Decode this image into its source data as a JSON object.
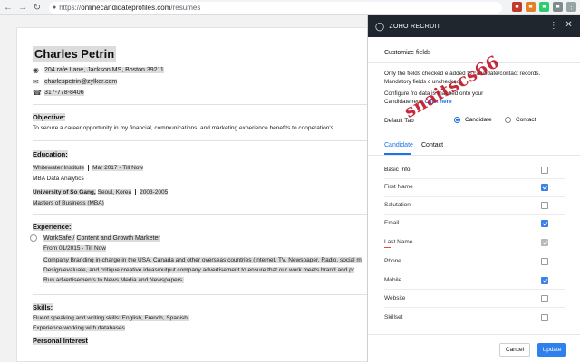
{
  "browser": {
    "url_host": "onlinecandidateprofiles.com",
    "url_path": "/resumes",
    "url_prefix": "https://"
  },
  "resume": {
    "name": "Charles Petrin",
    "address": "204 rafe Lane, Jackson MS, Boston 39211",
    "email": "charlespetrin@zylker.com",
    "phone": "317-778-8406",
    "objective_heading": "Objective:",
    "objective_text": "To secure a career opportunity in my financial, communications, and marketing experience benefits to cooperation's",
    "education_heading": "Education:",
    "edu1_school": "Whitewater Institute",
    "edu1_dates": "Mar 2017 - Till Now",
    "edu1_degree": "MBA Data Analytics",
    "edu2_school": "University of So Gang,",
    "edu2_location": "Seoul, Korea",
    "edu2_dates": "2003-2005",
    "edu2_degree": "Masters of Business (MBA)",
    "experience_heading": "Experience:",
    "exp_company": "WorkSafe /",
    "exp_title": "Content and Growth Marketer",
    "exp_dates": "From 01/2015 - Till Now",
    "exp_line1": "Company Branding in-charge in the USA, Canada and other overseas countries (Internet, TV, Newspaper, Radio, social m",
    "exp_line2": "Design/evaluate, and critique creative ideas/output company advertisement to ensure that our work meets brand and pr",
    "exp_line3": "Run advertisements to News Media and Newspapers.",
    "skills_heading": "Skills:",
    "skills_line1": "Fluent speaking and writing skills: English, French, Spanish.",
    "skills_line2": "Experience working with databases",
    "interest_heading": "Personal Interest"
  },
  "panel": {
    "app_title": "ZOHO RECRUIT",
    "section_title": "Customize fields",
    "note1_line1": "Only the fields checked",
    "note1_line1b": "e added to candidate/contact records.",
    "note1_line2": "Mandatory fields c",
    "note1_line2b": "unchecked.",
    "note2_line1": "Configure fro",
    "note2_line1b": "data is mapped onto your",
    "note2_line2": "Candidate reco",
    "note2_link": "Click here",
    "default_tab_label": "Default Tab",
    "radio_candidate": "Candidate",
    "radio_contact": "Contact",
    "tab_candidate": "Candidate",
    "tab_contact": "Contact",
    "fields": [
      {
        "label": "Basic Info",
        "state": "off"
      },
      {
        "label": "First Name",
        "state": "on"
      },
      {
        "label": "Salutation",
        "state": "off"
      },
      {
        "label": "Email",
        "state": "on"
      },
      {
        "label": "Last Name",
        "state": "disabled"
      },
      {
        "label": "Phone",
        "state": "off"
      },
      {
        "label": "Mobile",
        "state": "on"
      },
      {
        "label": "Website",
        "state": "off"
      },
      {
        "label": "Skillset",
        "state": "off"
      }
    ],
    "cancel_label": "Cancel",
    "update_label": "Update"
  },
  "watermark": "snaitscs66",
  "colors": {
    "accent": "#1a73e8",
    "panel_header": "#20262e",
    "checkbox_on": "#3b82e6",
    "update_button": "#2f80ed",
    "watermark": "#c0182a"
  }
}
